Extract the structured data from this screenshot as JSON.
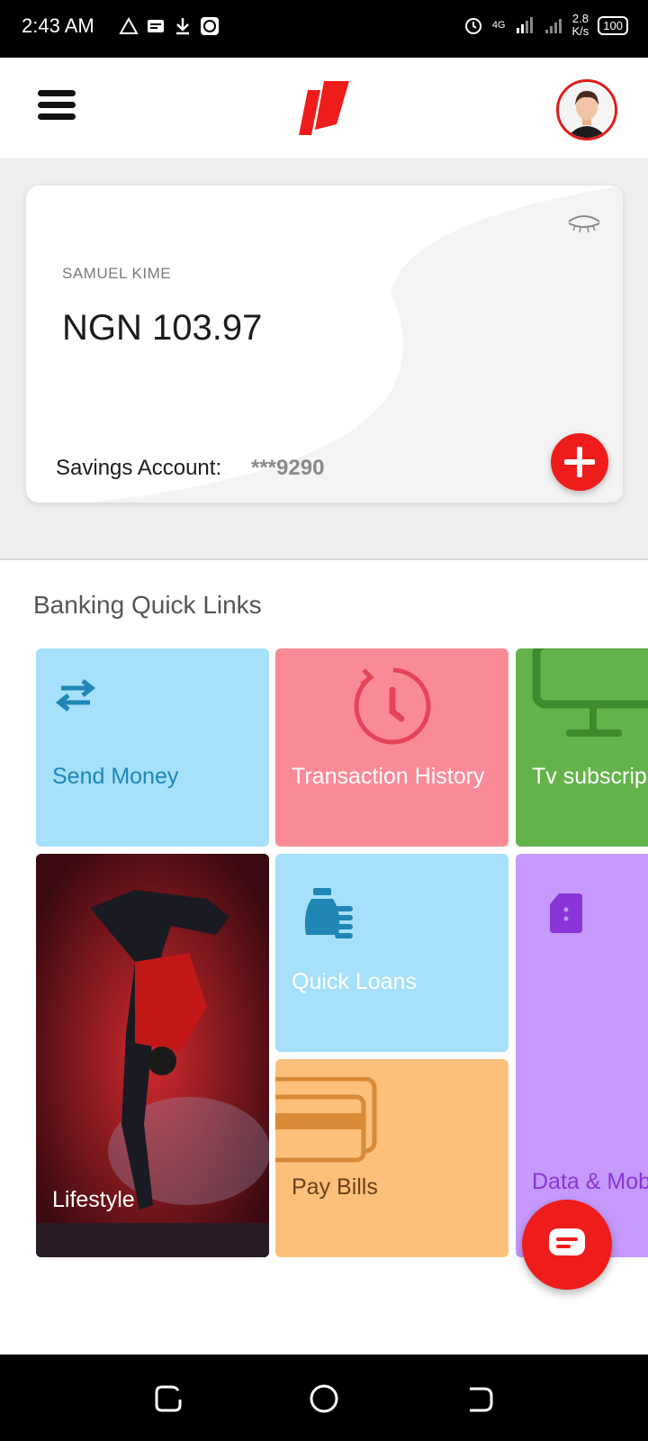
{
  "status_bar": {
    "time": "2:43 AM",
    "network": "4G",
    "speed_value": "2.8",
    "speed_unit": "K/s",
    "battery": "100"
  },
  "header": {
    "menu_icon": "hamburger-icon",
    "logo": "app-logo",
    "avatar": "profile-avatar"
  },
  "account_card": {
    "holder_name": "SAMUEL KIME",
    "balance": "NGN 103.97",
    "account_label": "Savings Account:",
    "account_number": "***9290",
    "visibility_icon": "eye-closed-icon",
    "add_icon": "plus-icon"
  },
  "quick_links": {
    "title": "Banking Quick Links",
    "items": [
      {
        "label": "Send Money",
        "icon": "transfer-arrows-icon"
      },
      {
        "label": "Transaction History",
        "icon": "clock-history-icon"
      },
      {
        "label": "Tv subscrip",
        "icon": "tv-monitor-icon"
      },
      {
        "label": "Lifestyle",
        "icon": "lifestyle-photo"
      },
      {
        "label": "Quick Loans",
        "icon": "money-bag-icon"
      },
      {
        "label": "Pay Bills",
        "icon": "credit-card-icon"
      },
      {
        "label": "Data & Mob",
        "icon": "sim-card-icon"
      }
    ]
  },
  "colors": {
    "brand_red": "#ef1c1c",
    "tile_blue": "#a6e0fb",
    "tile_pink": "#fb8a97",
    "tile_green": "#63b34a",
    "tile_orange": "#fcc07a",
    "tile_purple": "#c59afc"
  }
}
